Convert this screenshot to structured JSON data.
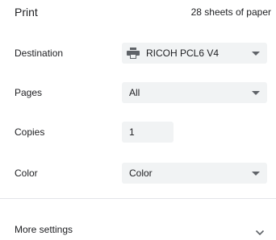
{
  "header": {
    "title": "Print",
    "sheets": "28 sheets of paper"
  },
  "fields": {
    "destination": {
      "label": "Destination",
      "value": "RICOH PCL6 V4",
      "icon": "printer-icon"
    },
    "pages": {
      "label": "Pages",
      "value": "All"
    },
    "copies": {
      "label": "Copies",
      "value": "1"
    },
    "color": {
      "label": "Color",
      "value": "Color"
    }
  },
  "more_settings": {
    "label": "More settings",
    "icon": "chevron-down-icon"
  },
  "colors": {
    "control_bg": "#f1f3f4",
    "text": "#202124",
    "icon": "#5f6368",
    "divider": "#e3e5e8"
  }
}
